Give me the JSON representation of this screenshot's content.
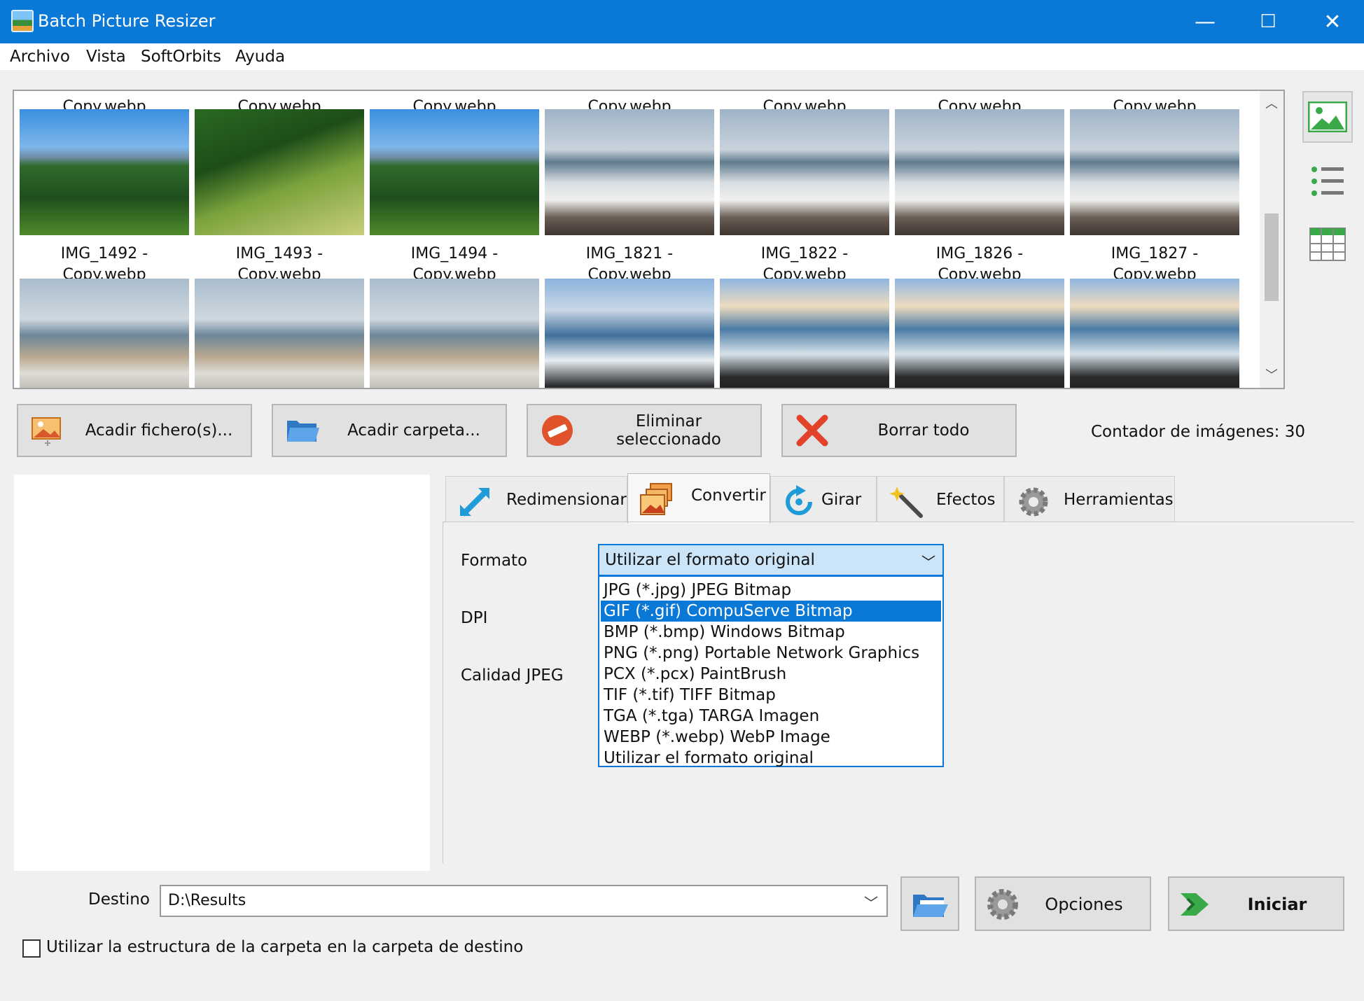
{
  "window": {
    "title": "Batch Picture Resizer",
    "minimize": "—",
    "maximize": "☐",
    "close": "✕"
  },
  "menu": [
    "Archivo",
    "Vista",
    "SoftOrbits",
    "Ayuda"
  ],
  "thumbnails": {
    "row1": [
      {
        "caption": "Copy.webp"
      },
      {
        "caption": "Copy.webp"
      },
      {
        "caption": "Copy.webp"
      },
      {
        "caption": "Copy.webp"
      },
      {
        "caption": "Copy.webp"
      },
      {
        "caption": "Copy.webp"
      },
      {
        "caption": "Copy.webp"
      }
    ],
    "row2": [
      {
        "line1": "IMG_1492 -",
        "line2": "Copy.webp"
      },
      {
        "line1": "IMG_1493 -",
        "line2": "Copy.webp"
      },
      {
        "line1": "IMG_1494 -",
        "line2": "Copy.webp"
      },
      {
        "line1": "IMG_1821 -",
        "line2": "Copy.webp"
      },
      {
        "line1": "IMG_1822 -",
        "line2": "Copy.webp"
      },
      {
        "line1": "IMG_1826 -",
        "line2": "Copy.webp"
      },
      {
        "line1": "IMG_1827 -",
        "line2": "Copy.webp"
      }
    ]
  },
  "actions": {
    "add_files": "Acadir fichero(s)...",
    "add_folder": "Acadir carpeta...",
    "remove_selected": "Eliminar seleccionado",
    "clear_all": "Borrar todo",
    "counter": "Contador de imágenes: 30"
  },
  "tabs": [
    "Redimensionar",
    "Convertir",
    "Girar",
    "Efectos",
    "Herramientas"
  ],
  "convert": {
    "format_label": "Formato",
    "dpi_label": "DPI",
    "jpeg_quality_label": "Calidad JPEG",
    "format_selected": "Utilizar el formato original",
    "options": [
      "JPG (*.jpg) JPEG Bitmap",
      "GIF (*.gif) CompuServe Bitmap",
      "BMP (*.bmp) Windows Bitmap",
      "PNG (*.png) Portable Network Graphics",
      "PCX (*.pcx) PaintBrush",
      "TIF (*.tif) TIFF Bitmap",
      "TGA (*.tga) TARGA Imagen",
      "WEBP (*.webp) WebP Image",
      "Utilizar el formato original"
    ],
    "highlighted_option": 1
  },
  "bottom": {
    "dest_label": "Destino",
    "dest_value": "D:\\Results",
    "options_button": "Opciones",
    "start_button": "Iniciar",
    "keep_structure_label": "Utilizar la estructura de la carpeta en la carpeta de destino"
  }
}
